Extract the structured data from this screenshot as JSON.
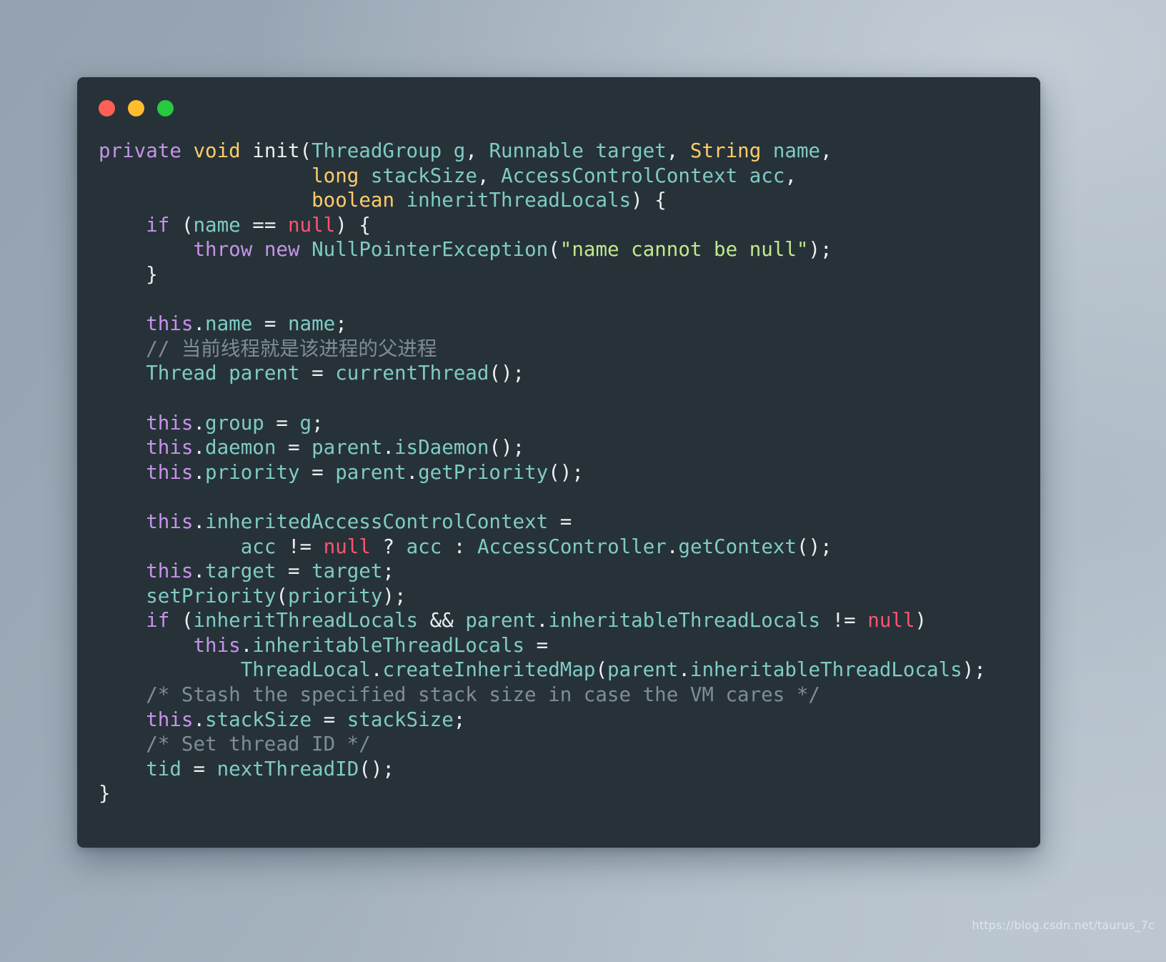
{
  "window": {
    "title": "",
    "background_color": "#263238",
    "traffic_lights": [
      {
        "name": "close",
        "color": "#ff5f56"
      },
      {
        "name": "minimize",
        "color": "#ffbd2e"
      },
      {
        "name": "maximize",
        "color": "#27c93f"
      }
    ]
  },
  "theme": {
    "page_background": "#9aa7b4",
    "editor_background": "#263238",
    "foreground": "#eceff1",
    "keyword": "#c792ea",
    "builtin_type": "#ffcb6b",
    "class_or_identifier": "#80cbc4",
    "null_literal": "#ff5370",
    "string_literal": "#c3e88d",
    "comment": "#808d93"
  },
  "code": {
    "language": "java",
    "lines": [
      "private void init(ThreadGroup g, Runnable target, String name,",
      "                  long stackSize, AccessControlContext acc,",
      "                  boolean inheritThreadLocals) {",
      "    if (name == null) {",
      "        throw new NullPointerException(\"name cannot be null\");",
      "    }",
      "",
      "    this.name = name;",
      "    // 当前线程就是该进程的父进程",
      "    Thread parent = currentThread();",
      "",
      "    this.group = g;",
      "    this.daemon = parent.isDaemon();",
      "    this.priority = parent.getPriority();",
      "",
      "    this.inheritedAccessControlContext =",
      "            acc != null ? acc : AccessController.getContext();",
      "    this.target = target;",
      "    setPriority(priority);",
      "    if (inheritThreadLocals && parent.inheritableThreadLocals != null)",
      "        this.inheritableThreadLocals =",
      "            ThreadLocal.createInheritedMap(parent.inheritableThreadLocals);",
      "    /* Stash the specified stack size in case the VM cares */",
      "    this.stackSize = stackSize;",
      "    /* Set thread ID */",
      "    tid = nextThreadID();",
      "}"
    ],
    "comments": [
      "// 当前线程就是该进程的父进程",
      "/* Stash the specified stack size in case the VM cares */",
      "/* Set thread ID */"
    ],
    "string_literals": [
      "\"name cannot be null\""
    ]
  },
  "watermark": {
    "text": "https://blog.csdn.net/taurus_7c"
  }
}
